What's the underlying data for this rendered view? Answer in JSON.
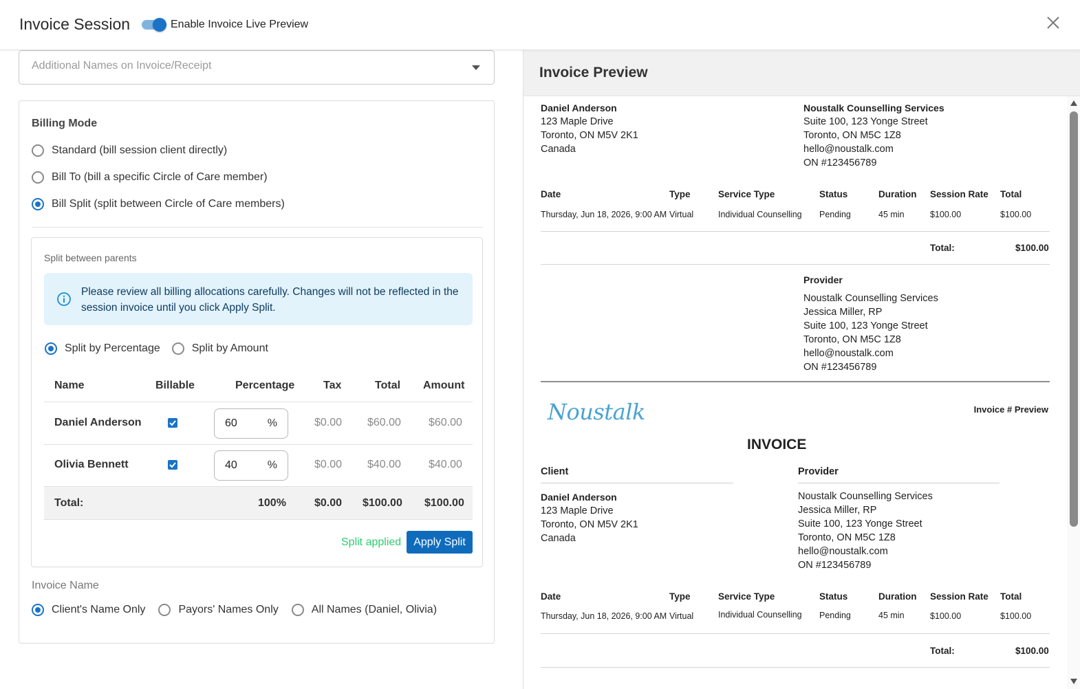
{
  "header": {
    "title": "Invoice Session",
    "toggle_label": "Enable Invoice Live Preview",
    "toggle_on": true
  },
  "left": {
    "additional_names_placeholder": "Additional Names on Invoice/Receipt",
    "billing_mode": {
      "title": "Billing Mode",
      "options": [
        {
          "label": "Standard (bill session client directly)",
          "selected": false
        },
        {
          "label": "Bill To (bill a specific Circle of Care member)",
          "selected": false
        },
        {
          "label": "Bill Split (split between Circle of Care members)",
          "selected": true
        }
      ]
    },
    "split": {
      "title": "Split between parents",
      "alert": "Please review all billing allocations carefully. Changes will not be reflected in the session invoice until you click Apply Split.",
      "modes": [
        {
          "label": "Split by Percentage",
          "selected": true
        },
        {
          "label": "Split by Amount",
          "selected": false
        }
      ],
      "columns": [
        "Name",
        "Billable",
        "Percentage",
        "Tax",
        "Total",
        "Amount"
      ],
      "rows": [
        {
          "name": "Daniel Anderson",
          "billable": true,
          "percentage": "60",
          "unit": "%",
          "tax": "$0.00",
          "total": "$60.00",
          "amount": "$60.00"
        },
        {
          "name": "Olivia Bennett",
          "billable": true,
          "percentage": "40",
          "unit": "%",
          "tax": "$0.00",
          "total": "$40.00",
          "amount": "$40.00"
        }
      ],
      "totals": {
        "label": "Total:",
        "percentage": "100%",
        "tax": "$0.00",
        "total": "$100.00",
        "amount": "$100.00"
      },
      "status": "Split applied",
      "apply_label": "Apply Split"
    },
    "invoice_name": {
      "label": "Invoice Name",
      "options": [
        {
          "label": "Client's Name Only",
          "selected": true
        },
        {
          "label": "Payors' Names Only",
          "selected": false
        },
        {
          "label": "All Names (Daniel, Olivia)",
          "selected": false
        }
      ]
    }
  },
  "preview": {
    "title": "Invoice Preview",
    "client": {
      "name": "Daniel Anderson",
      "line1": "123 Maple Drive",
      "line2": "Toronto, ON M5V 2K1",
      "line3": "Canada"
    },
    "org": {
      "name": "Noustalk Counselling Services",
      "line1": "Suite 100, 123 Yonge Street",
      "line2": "Toronto, ON M5C 1Z8",
      "line3": "hello@noustalk.com",
      "line4": "ON #123456789"
    },
    "table": {
      "headers": [
        "Date",
        "Type",
        "Service Type",
        "Status",
        "Duration",
        "Session Rate",
        "Total"
      ],
      "row": [
        "Thursday, Jun 18, 2026, 9:00 AM",
        "Virtual",
        "Individual Counselling",
        "Pending",
        "45 min",
        "$100.00",
        "$100.00"
      ],
      "total_label": "Total:",
      "total_value": "$100.00"
    },
    "provider": {
      "label": "Provider",
      "org": "Noustalk Counselling Services",
      "name": "Jessica Miller, RP",
      "line1": "Suite 100, 123 Yonge Street",
      "line2": "Toronto, ON M5C 1Z8",
      "line3": "hello@noustalk.com",
      "line4": "ON #123456789"
    },
    "logo": "Noustalk",
    "invoice_no": "Invoice # Preview",
    "invoice_title": "INVOICE",
    "client_label": "Client",
    "provider_label": "Provider",
    "provider2_line2": "Toronto, ON M5C 1Z8"
  }
}
